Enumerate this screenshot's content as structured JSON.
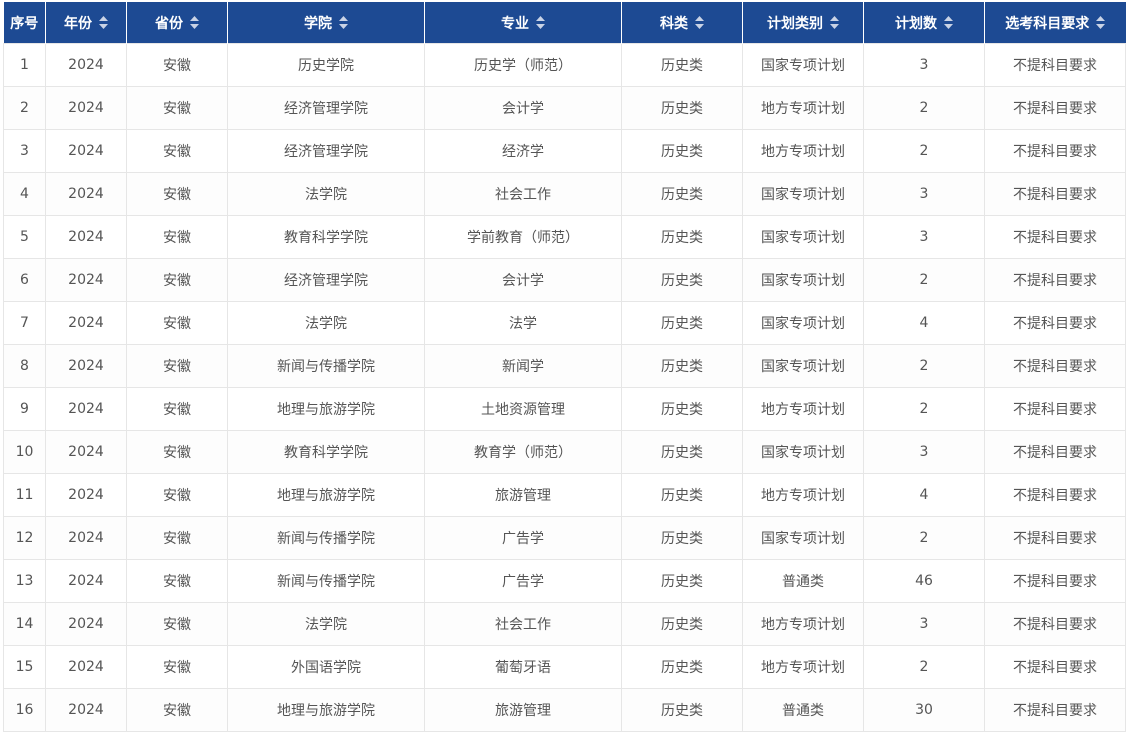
{
  "colors": {
    "header_bg": "#1d4a93",
    "header_text": "#ffffff",
    "cell_text": "#555555",
    "border": "#e6e6e6"
  },
  "table": {
    "columns": [
      {
        "label": "序号",
        "sortable": false,
        "icon": ""
      },
      {
        "label": "年份",
        "sortable": true,
        "icon": "sort-icon"
      },
      {
        "label": "省份",
        "sortable": true,
        "icon": "sort-icon"
      },
      {
        "label": "学院",
        "sortable": true,
        "icon": "sort-icon"
      },
      {
        "label": "专业",
        "sortable": true,
        "icon": "sort-icon"
      },
      {
        "label": "科类",
        "sortable": true,
        "icon": "sort-icon"
      },
      {
        "label": "计划类别",
        "sortable": true,
        "icon": "sort-icon"
      },
      {
        "label": "计划数",
        "sortable": true,
        "icon": "sort-icon"
      },
      {
        "label": "选考科目要求",
        "sortable": true,
        "icon": "sort-icon"
      }
    ],
    "rows": [
      [
        "1",
        "2024",
        "安徽",
        "历史学院",
        "历史学（师范）",
        "历史类",
        "国家专项计划",
        "3",
        "不提科目要求"
      ],
      [
        "2",
        "2024",
        "安徽",
        "经济管理学院",
        "会计学",
        "历史类",
        "地方专项计划",
        "2",
        "不提科目要求"
      ],
      [
        "3",
        "2024",
        "安徽",
        "经济管理学院",
        "经济学",
        "历史类",
        "地方专项计划",
        "2",
        "不提科目要求"
      ],
      [
        "4",
        "2024",
        "安徽",
        "法学院",
        "社会工作",
        "历史类",
        "国家专项计划",
        "3",
        "不提科目要求"
      ],
      [
        "5",
        "2024",
        "安徽",
        "教育科学学院",
        "学前教育（师范）",
        "历史类",
        "国家专项计划",
        "3",
        "不提科目要求"
      ],
      [
        "6",
        "2024",
        "安徽",
        "经济管理学院",
        "会计学",
        "历史类",
        "国家专项计划",
        "2",
        "不提科目要求"
      ],
      [
        "7",
        "2024",
        "安徽",
        "法学院",
        "法学",
        "历史类",
        "国家专项计划",
        "4",
        "不提科目要求"
      ],
      [
        "8",
        "2024",
        "安徽",
        "新闻与传播学院",
        "新闻学",
        "历史类",
        "国家专项计划",
        "2",
        "不提科目要求"
      ],
      [
        "9",
        "2024",
        "安徽",
        "地理与旅游学院",
        "土地资源管理",
        "历史类",
        "地方专项计划",
        "2",
        "不提科目要求"
      ],
      [
        "10",
        "2024",
        "安徽",
        "教育科学学院",
        "教育学（师范）",
        "历史类",
        "国家专项计划",
        "3",
        "不提科目要求"
      ],
      [
        "11",
        "2024",
        "安徽",
        "地理与旅游学院",
        "旅游管理",
        "历史类",
        "地方专项计划",
        "4",
        "不提科目要求"
      ],
      [
        "12",
        "2024",
        "安徽",
        "新闻与传播学院",
        "广告学",
        "历史类",
        "国家专项计划",
        "2",
        "不提科目要求"
      ],
      [
        "13",
        "2024",
        "安徽",
        "新闻与传播学院",
        "广告学",
        "历史类",
        "普通类",
        "46",
        "不提科目要求"
      ],
      [
        "14",
        "2024",
        "安徽",
        "法学院",
        "社会工作",
        "历史类",
        "地方专项计划",
        "3",
        "不提科目要求"
      ],
      [
        "15",
        "2024",
        "安徽",
        "外国语学院",
        "葡萄牙语",
        "历史类",
        "地方专项计划",
        "2",
        "不提科目要求"
      ],
      [
        "16",
        "2024",
        "安徽",
        "地理与旅游学院",
        "旅游管理",
        "历史类",
        "普通类",
        "30",
        "不提科目要求"
      ]
    ]
  }
}
